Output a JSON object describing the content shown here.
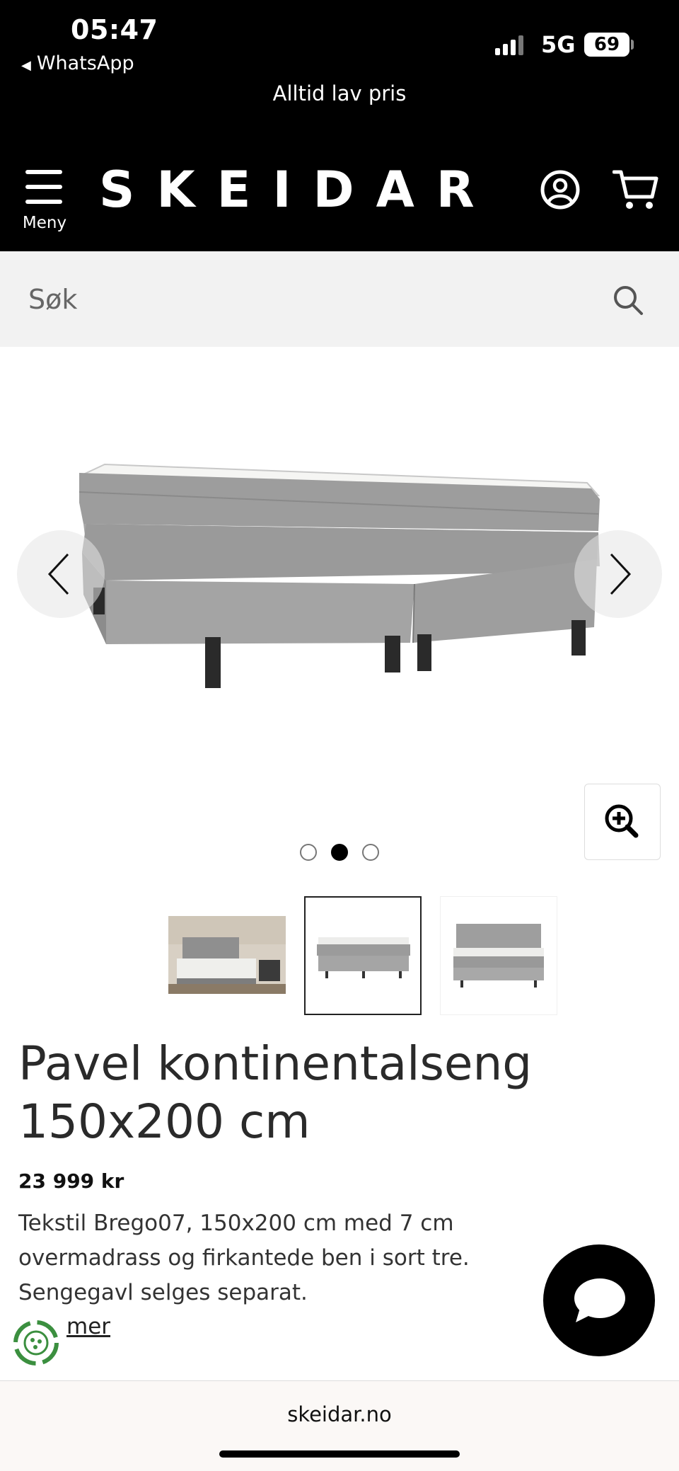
{
  "status_bar": {
    "time": "05:47",
    "back_app": "WhatsApp",
    "network": "5G",
    "battery": "69"
  },
  "promo_banner": "Alltid lav pris",
  "header": {
    "menu_label": "Meny",
    "logo": "SKEIDAR",
    "icons": [
      "menu-icon",
      "account-icon",
      "cart-icon"
    ]
  },
  "search": {
    "placeholder": "Søk",
    "icon": "search-icon"
  },
  "gallery": {
    "image_count": 3,
    "active_index": 1,
    "icons": [
      "chevron-left-icon",
      "chevron-right-icon",
      "zoom-in-icon"
    ]
  },
  "product": {
    "title": "Pavel kontinentalseng 150x200 cm",
    "price": "23 999 kr",
    "description": "Tekstil Brego07, 150x200 cm med 7 cm overmadrass og firkantede ben i sort tre. Sengegavl selges separat.",
    "more_link": "mer"
  },
  "chat": {
    "icon": "chat-bubble-icon"
  },
  "browser": {
    "url": "skeidar.no"
  },
  "colors": {
    "header_bg": "#000000",
    "search_bg": "#f2f2f2",
    "text": "#222222",
    "eco_green": "#3b8f3f"
  }
}
